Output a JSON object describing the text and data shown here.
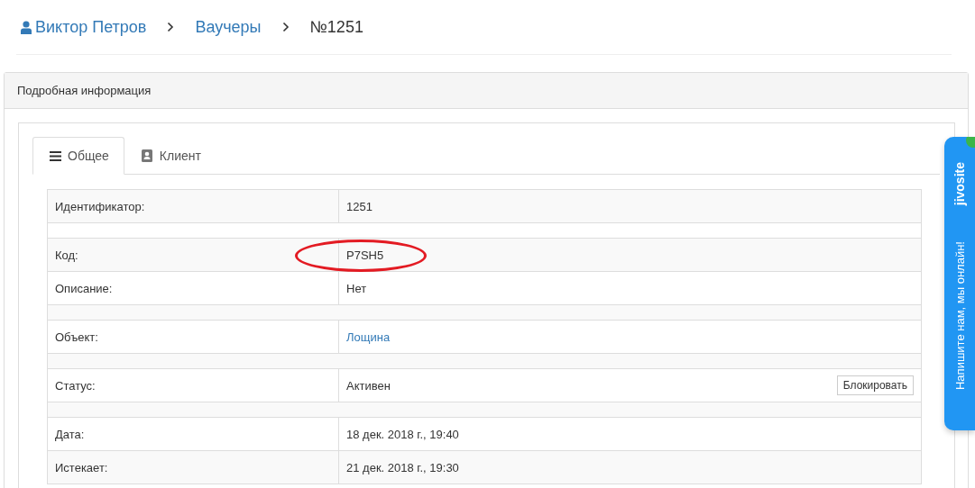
{
  "breadcrumb": [
    {
      "label": "Виктор Петров",
      "kind": "user"
    },
    {
      "label": "Ваучеры",
      "kind": "link"
    },
    {
      "label": "№1251",
      "kind": "current"
    }
  ],
  "panel": {
    "title": "Подробная информация"
  },
  "tabs": [
    {
      "label": "Общее",
      "selected": true
    },
    {
      "label": "Клиент",
      "selected": false
    }
  ],
  "rows": [
    {
      "kind": "field",
      "label": "Идентификатор:",
      "value": "1251"
    },
    {
      "kind": "spacer"
    },
    {
      "kind": "field",
      "label": "Код:",
      "value": "P7SH5",
      "circled": true
    },
    {
      "kind": "field",
      "label": "Описание:",
      "value": "Нет"
    },
    {
      "kind": "spacer"
    },
    {
      "kind": "field",
      "label": "Объект:",
      "value": "Лощина",
      "link": true
    },
    {
      "kind": "spacer"
    },
    {
      "kind": "field",
      "label": "Статус:",
      "value": "Активен",
      "button": "Блокировать"
    },
    {
      "kind": "spacer"
    },
    {
      "kind": "field",
      "label": "Дата:",
      "value": "18 дек. 2018 г., 19:40"
    },
    {
      "kind": "field",
      "label": "Истекает:",
      "value": "21 дек. 2018 г., 19:30"
    }
  ],
  "chat_widget": {
    "brand": "jivosite",
    "text": "Напишите нам, мы онлайн!"
  }
}
